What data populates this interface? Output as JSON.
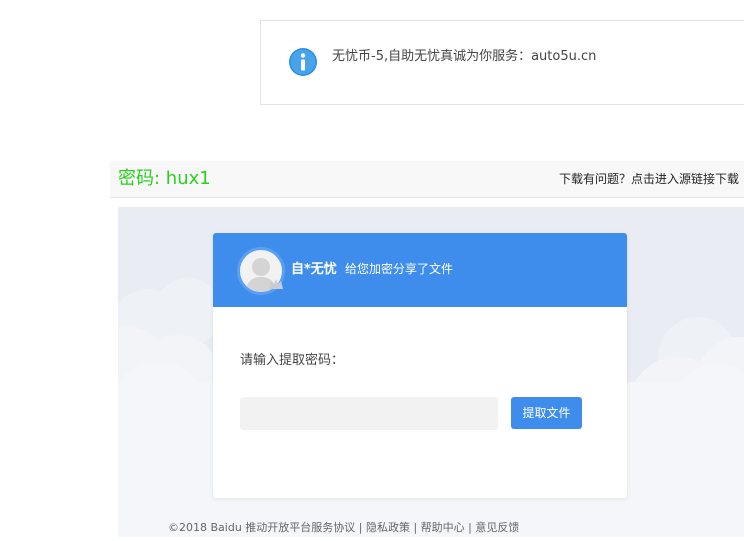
{
  "notice": {
    "icon": "info-icon",
    "text": "无忧币-5,自助无忧真诚为你服务：auto5u.cn"
  },
  "panel": {
    "password_label": "密码: hux1",
    "source_link": "下载有问题？点击进入源链接下载"
  },
  "share_card": {
    "avatar_icon": "user-avatar-icon",
    "sharer_name": "自*无忧",
    "share_desc": "给您加密分享了文件",
    "prompt": "请输入提取密码：",
    "code_input_value": "",
    "extract_button": "提取文件"
  },
  "footer": {
    "text": "©2018 Baidu 推动开放平台服务协议 | 隐私政策 | 帮助中心 | 意见反馈"
  },
  "colors": {
    "accent": "#3e8ded",
    "password_green": "#2bcf1f",
    "background_grey": "#e9ecf2"
  }
}
